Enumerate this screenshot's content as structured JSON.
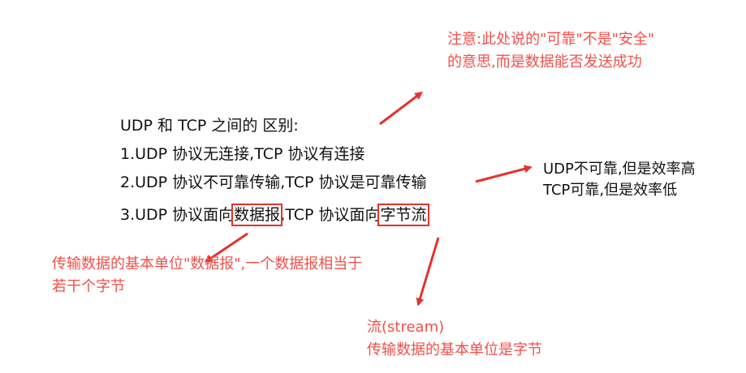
{
  "main": {
    "title": "UDP 和 TCP 之间的 区别:",
    "line1": "1.UDP 协议无连接,TCP 协议有连接",
    "line2": "2.UDP 协议不可靠传输,TCP 协议是可靠传输",
    "line3_prefix": "3.UDP 协议面向",
    "line3_box1": "数据报",
    "line3_middle": ",TCP 协议面向",
    "line3_box2": "字节流"
  },
  "notes": {
    "reliable_1": "注意:此处说的\"可靠\"不是\"安全\"",
    "reliable_2": "的意思,而是数据能否发送成功",
    "efficiency_1": "UDP不可靠,但是效率高",
    "efficiency_2": "TCP可靠,但是效率低",
    "datagram_1": "传输数据的基本单位\"数据报\",一个数据报相当于",
    "datagram_2": "若干个字节",
    "stream_1": "流(stream)",
    "stream_2": "传输数据的基本单位是字节"
  },
  "colors": {
    "annotation_red": "#f0504a",
    "box_red": "#e5322d",
    "text": "#111111"
  }
}
